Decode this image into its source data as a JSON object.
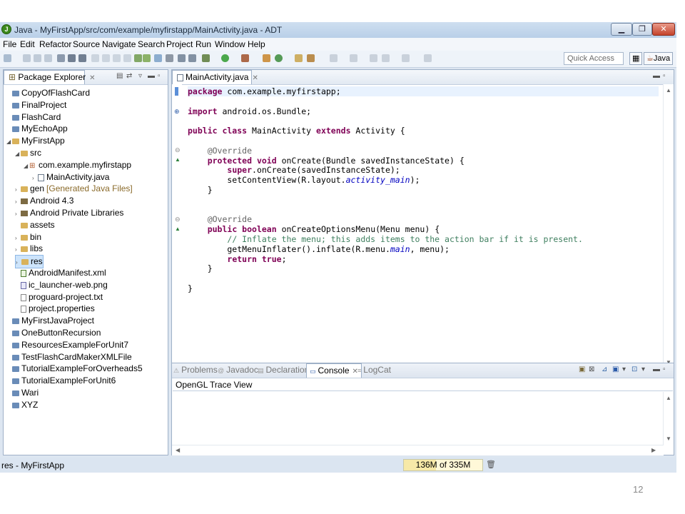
{
  "window": {
    "title": "Java - MyFirstApp/src/com/example/myfirstapp/MainActivity.java - ADT",
    "app_icon_glyph": "J"
  },
  "menu": [
    "File",
    "Edit",
    "Refactor",
    "Source",
    "Navigate",
    "Search",
    "Project",
    "Run",
    "Window",
    "Help"
  ],
  "toolbar": {
    "quick_access_placeholder": "Quick Access",
    "perspective_label": "Java"
  },
  "package_explorer": {
    "tab_label": "Package Explorer",
    "items": [
      {
        "label": "CopyOfFlashCard",
        "depth": 0,
        "icon": "project-folder-icon",
        "twist": ""
      },
      {
        "label": "FinalProject",
        "depth": 0,
        "icon": "project-folder-icon",
        "twist": ""
      },
      {
        "label": "FlashCard",
        "depth": 0,
        "icon": "project-folder-icon",
        "twist": ""
      },
      {
        "label": "MyEchoApp",
        "depth": 0,
        "icon": "project-folder-icon",
        "twist": ""
      },
      {
        "label": "MyFirstApp",
        "depth": 0,
        "icon": "android-project-icon",
        "twist": "◢"
      },
      {
        "label": "src",
        "depth": 1,
        "icon": "source-folder-icon",
        "twist": "◢"
      },
      {
        "label": "com.example.myfirstapp",
        "depth": 2,
        "icon": "package-icon",
        "twist": "◢"
      },
      {
        "label": "MainActivity.java",
        "depth": 3,
        "icon": "java-file-icon",
        "twist": "›"
      },
      {
        "label": "gen",
        "suffix": "[Generated Java Files]",
        "depth": 1,
        "icon": "gen-folder-icon",
        "twist": "›"
      },
      {
        "label": "Android 4.3",
        "depth": 1,
        "icon": "library-icon",
        "twist": "›"
      },
      {
        "label": "Android Private Libraries",
        "depth": 1,
        "icon": "library-icon",
        "twist": "›"
      },
      {
        "label": "assets",
        "depth": 1,
        "icon": "folder-icon",
        "twist": ""
      },
      {
        "label": "bin",
        "depth": 1,
        "icon": "folder-icon",
        "twist": "›"
      },
      {
        "label": "libs",
        "depth": 1,
        "icon": "folder-icon",
        "twist": "›"
      },
      {
        "label": "res",
        "depth": 1,
        "icon": "folder-icon",
        "twist": "›",
        "selected": true
      },
      {
        "label": "AndroidManifest.xml",
        "depth": 1,
        "icon": "xml-file-icon",
        "twist": ""
      },
      {
        "label": "ic_launcher-web.png",
        "depth": 1,
        "icon": "png-file-icon",
        "twist": ""
      },
      {
        "label": "proguard-project.txt",
        "depth": 1,
        "icon": "text-file-icon",
        "twist": ""
      },
      {
        "label": "project.properties",
        "depth": 1,
        "icon": "text-file-icon",
        "twist": ""
      },
      {
        "label": "MyFirstJavaProject",
        "depth": 0,
        "icon": "project-folder-icon",
        "twist": ""
      },
      {
        "label": "OneButtonRecursion",
        "depth": 0,
        "icon": "project-folder-icon",
        "twist": ""
      },
      {
        "label": "ResourcesExampleForUnit7",
        "depth": 0,
        "icon": "project-folder-icon",
        "twist": ""
      },
      {
        "label": "TestFlashCardMakerXMLFile",
        "depth": 0,
        "icon": "project-folder-icon",
        "twist": ""
      },
      {
        "label": "TutorialExampleForOverheads5",
        "depth": 0,
        "icon": "project-folder-icon",
        "twist": ""
      },
      {
        "label": "TutorialExampleForUnit6",
        "depth": 0,
        "icon": "project-folder-icon",
        "twist": ""
      },
      {
        "label": "Wari",
        "depth": 0,
        "icon": "project-folder-icon",
        "twist": ""
      },
      {
        "label": "XYZ",
        "depth": 0,
        "icon": "project-folder-icon",
        "twist": ""
      }
    ]
  },
  "editor": {
    "tab_label": "MainActivity.java",
    "code_lines": [
      [
        [
          "kw",
          "package"
        ],
        [
          "t",
          " com.example.myfirstapp;"
        ]
      ],
      [],
      [
        [
          "kw",
          "import"
        ],
        [
          "t",
          " android.os.Bundle;"
        ]
      ],
      [],
      [
        [
          "kw",
          "public class"
        ],
        [
          "t",
          " MainActivity "
        ],
        [
          "kw",
          "extends"
        ],
        [
          "t",
          " Activity {"
        ]
      ],
      [],
      [
        [
          "t",
          "    "
        ],
        [
          "ann",
          "@Override"
        ]
      ],
      [
        [
          "t",
          "    "
        ],
        [
          "kw",
          "protected void"
        ],
        [
          "t",
          " onCreate(Bundle savedInstanceState) {"
        ]
      ],
      [
        [
          "t",
          "        "
        ],
        [
          "kw",
          "super"
        ],
        [
          "t",
          ".onCreate(savedInstanceState);"
        ]
      ],
      [
        [
          "t",
          "        setContentView(R.layout."
        ],
        [
          "fld",
          "activity_main"
        ],
        [
          "t",
          ");"
        ]
      ],
      [
        [
          "t",
          "    }"
        ]
      ],
      [],
      [],
      [
        [
          "t",
          "    "
        ],
        [
          "ann",
          "@Override"
        ]
      ],
      [
        [
          "t",
          "    "
        ],
        [
          "kw",
          "public boolean"
        ],
        [
          "t",
          " onCreateOptionsMenu(Menu menu) {"
        ]
      ],
      [
        [
          "t",
          "        "
        ],
        [
          "cm",
          "// Inflate the menu; this adds items to the action bar if it is present."
        ]
      ],
      [
        [
          "t",
          "        getMenuInflater().inflate(R.menu."
        ],
        [
          "fld",
          "main"
        ],
        [
          "t",
          ", menu);"
        ]
      ],
      [
        [
          "t",
          "        "
        ],
        [
          "kw",
          "return true"
        ],
        [
          "t",
          ";"
        ]
      ],
      [
        [
          "t",
          "    }"
        ]
      ],
      [],
      [
        [
          "t",
          "}"
        ]
      ]
    ]
  },
  "bottom_panel": {
    "tabs": [
      {
        "label": "Problems",
        "icon": "problems-icon"
      },
      {
        "label": "Javadoc",
        "icon": "javadoc-icon"
      },
      {
        "label": "Declaration",
        "icon": "declaration-icon"
      },
      {
        "label": "Console",
        "icon": "console-icon",
        "active": true
      },
      {
        "label": "LogCat",
        "icon": "logcat-icon"
      }
    ],
    "console_title": "OpenGL Trace View"
  },
  "status": {
    "selection": "res - MyFirstApp",
    "heap": "136M of 335M",
    "heap_used_fraction": 0.41
  },
  "slide_number": "12",
  "colors": {
    "keyword": "#7f0055",
    "comment": "#3f7f5f",
    "field": "#0000c0",
    "annotation": "#646464"
  }
}
